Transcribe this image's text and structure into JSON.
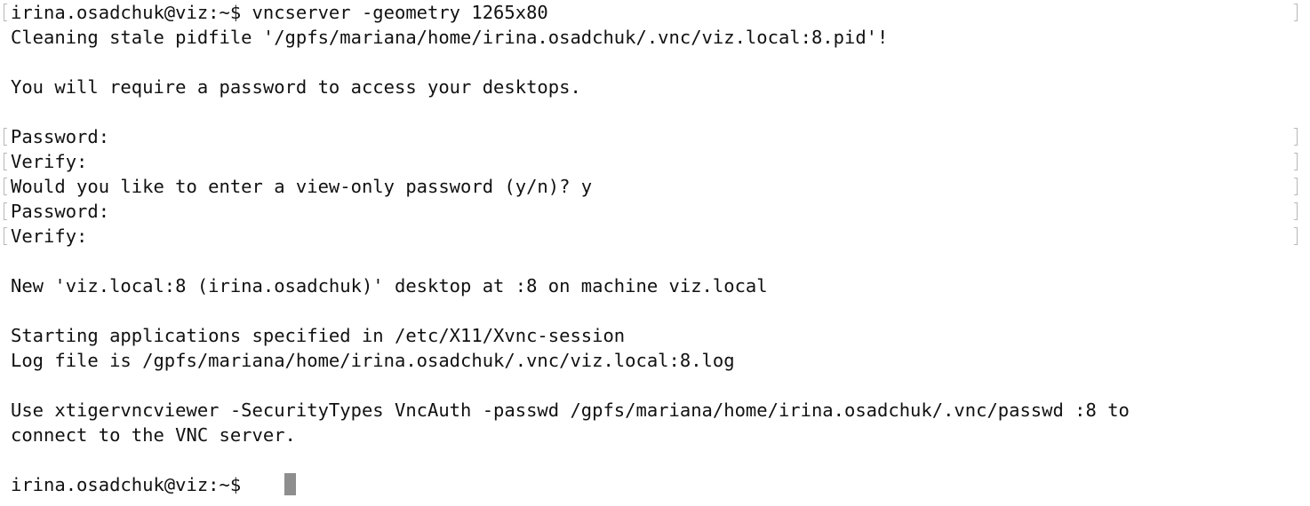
{
  "terminal": {
    "lines": [
      "irina.osadchuk@viz:~$ vncserver -geometry 1265x80",
      "Cleaning stale pidfile '/gpfs/mariana/home/irina.osadchuk/.vnc/viz.local:8.pid'!",
      "",
      "You will require a password to access your desktops.",
      "",
      "Password:",
      "Verify:",
      "Would you like to enter a view-only password (y/n)? y",
      "Password:",
      "Verify:",
      "",
      "New 'viz.local:8 (irina.osadchuk)' desktop at :8 on machine viz.local",
      "",
      "Starting applications specified in /etc/X11/Xvnc-session",
      "Log file is /gpfs/mariana/home/irina.osadchuk/.vnc/viz.local:8.log",
      "",
      "Use xtigervncviewer -SecurityTypes VncAuth -passwd /gpfs/mariana/home/irina.osadchuk/.vnc/passwd :8 to",
      "connect to the VNC server.",
      "",
      "irina.osadchuk@viz:~$ "
    ],
    "cursor_color": "#8e8e8e",
    "background_color": "#ffffff",
    "text_color": "#111111"
  }
}
